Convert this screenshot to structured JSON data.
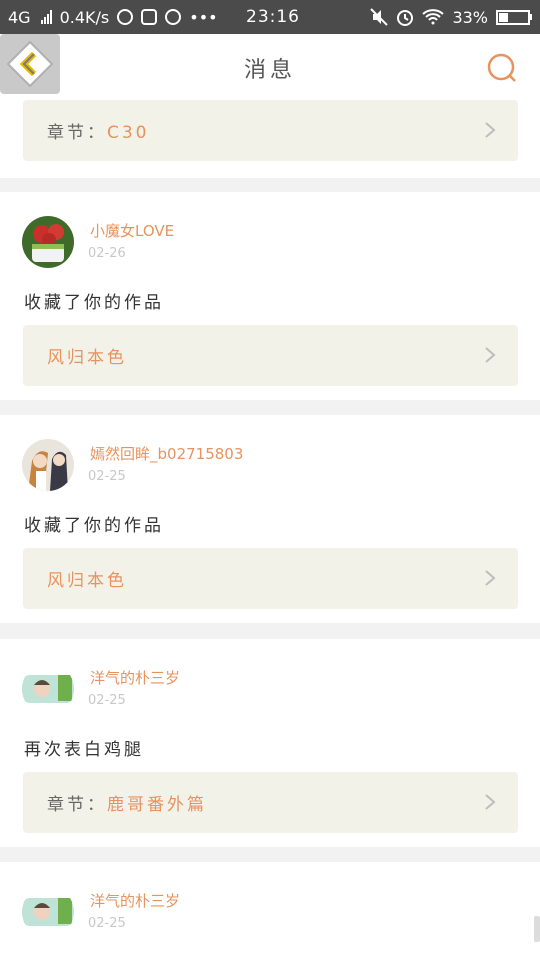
{
  "status_bar": {
    "network": "4G",
    "speed": "0.4K/s",
    "time": "23:16",
    "battery": "33%",
    "battery_level": 0.33
  },
  "header": {
    "title": "消息"
  },
  "colors": {
    "accent": "#e7935f",
    "card_bg": "#ffffff",
    "ref_bg": "#f2f2e9",
    "page_bg": "#f2f2f2"
  },
  "feed": {
    "top_ref": {
      "prefix": "章节：",
      "value": "C30"
    },
    "items": [
      {
        "user": "小魔女LOVE",
        "date": "02-26",
        "message": "收藏了你的作品",
        "ref_prefix": "",
        "ref_value": "风归本色"
      },
      {
        "user": "嫣然回眸_b02715803",
        "date": "02-25",
        "message": "收藏了你的作品",
        "ref_prefix": "",
        "ref_value": "风归本色"
      },
      {
        "user": "洋气的朴三岁",
        "date": "02-25",
        "message": "再次表白鸡腿",
        "ref_prefix": "章节：",
        "ref_value": "鹿哥番外篇"
      },
      {
        "user": "洋气的朴三岁",
        "date": "02-25",
        "message": "",
        "ref_prefix": "",
        "ref_value": ""
      }
    ]
  }
}
